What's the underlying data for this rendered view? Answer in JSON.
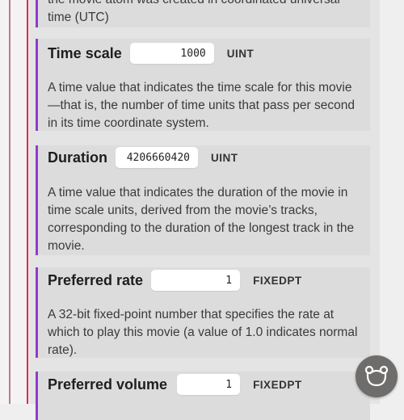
{
  "top_description": "the movie atom was created in coordinated universal time (UTC)",
  "fields": [
    {
      "label": "Time scale",
      "value": "1000",
      "type": "UINT",
      "description": "A time value that indicates the time scale for this movie—that is, the number of time units that pass per second in its time coordinate system."
    },
    {
      "label": "Duration",
      "value": "4206660420",
      "type": "UINT",
      "description": "A time value that indicates the duration of the movie in time scale units, derived from the movie’s tracks, corresponding to the duration of the longest track in the movie."
    },
    {
      "label": "Preferred rate",
      "value": "1",
      "type": "FIXEDPT",
      "description": "A 32-bit fixed-point number that specifies the rate at which to play this movie (a value of 1.0 indicates normal rate)."
    },
    {
      "label": "Preferred volume",
      "value": "1",
      "type": "FIXEDPT"
    }
  ],
  "fab_icon": "bear-face-icon",
  "colors": {
    "accent_left_line": "#e6254f",
    "field_border": "#8f3bd1",
    "fab_background": "#6f6d6b"
  }
}
